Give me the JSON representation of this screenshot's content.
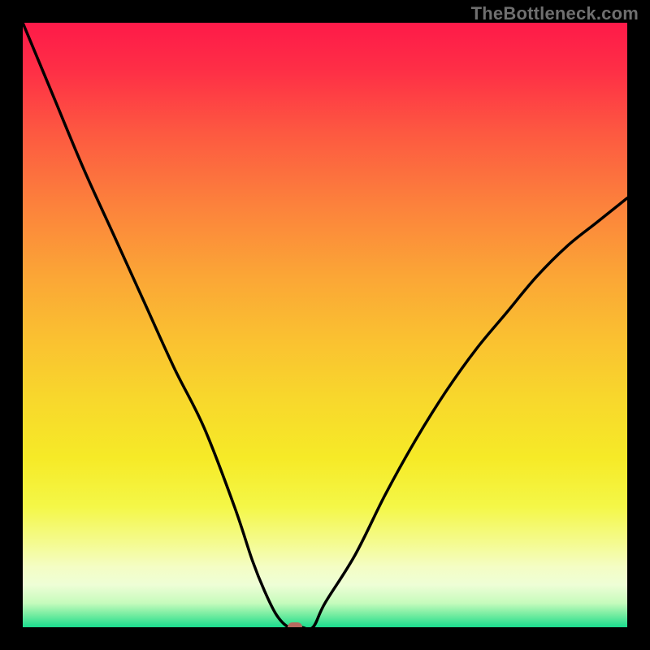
{
  "watermark": "TheBottleneck.com",
  "colors": {
    "frame": "#000000",
    "curve": "#000000",
    "marker": "#b6695f",
    "gradient_top": "#fe1a49",
    "gradient_bottom": "#1adc8e"
  },
  "chart_data": {
    "type": "line",
    "title": "",
    "xlabel": "",
    "ylabel": "",
    "xlim": [
      0,
      100
    ],
    "ylim": [
      0,
      100
    ],
    "grid": false,
    "legend": false,
    "series": [
      {
        "name": "bottleneck-curve",
        "x": [
          0,
          5,
          10,
          15,
          20,
          25,
          30,
          35,
          38,
          40,
          42,
          44,
          46,
          48,
          50,
          55,
          60,
          65,
          70,
          75,
          80,
          85,
          90,
          95,
          100
        ],
        "y": [
          100,
          88,
          76,
          65,
          54,
          43,
          33,
          20,
          11,
          6,
          2,
          0,
          0,
          0,
          4,
          12,
          22,
          31,
          39,
          46,
          52,
          58,
          63,
          67,
          71
        ]
      }
    ],
    "marker": {
      "x": 45,
      "y": 0
    },
    "notes": "V-shaped bottleneck curve over rainbow heat gradient; minimum around x≈44–46, y≈0."
  }
}
